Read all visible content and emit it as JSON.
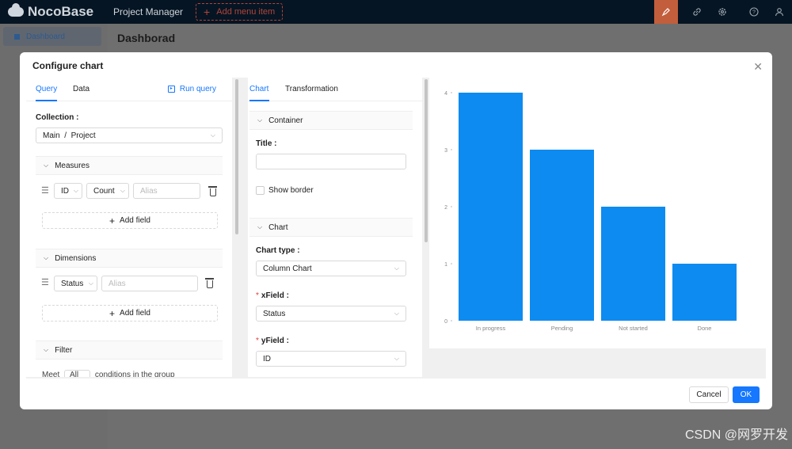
{
  "topbar": {
    "logo": "NocoBase",
    "project_menu": "Project Manager",
    "add_menu_item": "Add menu item",
    "icons": [
      "highlighter-icon",
      "link-icon",
      "gear-icon",
      "help-icon",
      "user-icon"
    ]
  },
  "sidebar": {
    "items": [
      {
        "label": "Dashboard",
        "icon": "dashboard-icon"
      }
    ]
  },
  "page": {
    "title": "Dashborad"
  },
  "modal": {
    "title": "Configure chart",
    "query_panel": {
      "tabs": [
        "Query",
        "Data"
      ],
      "run_query": "Run query",
      "collection_label": "Collection",
      "collection_value": "Main  /  Project",
      "measures": {
        "title": "Measures",
        "field": "ID",
        "aggregation": "Count",
        "alias_placeholder": "Alias",
        "add_field": "Add field"
      },
      "dimensions": {
        "title": "Dimensions",
        "field": "Status",
        "alias_placeholder": "Alias",
        "add_field": "Add field"
      },
      "filter": {
        "title": "Filter",
        "meet_prefix": "Meet",
        "meet_value": "All",
        "meet_suffix": "conditions in the group"
      }
    },
    "chart_panel": {
      "tabs": [
        "Chart",
        "Transformation"
      ],
      "container_section": "Container",
      "title_label": "Title",
      "show_border": "Show border",
      "chart_section": "Chart",
      "chart_type_label": "Chart type",
      "chart_type_value": "Column Chart",
      "xfield_label": "xField",
      "xfield_value": "Status",
      "yfield_label": "yField",
      "yfield_value": "ID"
    },
    "buttons": {
      "cancel": "Cancel",
      "ok": "OK"
    }
  },
  "chart_data": {
    "type": "bar",
    "categories": [
      "In progress",
      "Pending",
      "Not started",
      "Done"
    ],
    "values": [
      4,
      3,
      2,
      1
    ],
    "ylim": [
      0,
      4
    ],
    "yticks": [
      "0",
      "1",
      "2",
      "3",
      "4"
    ],
    "color": "#0d8bf0",
    "grid": false
  },
  "watermark": "CSDN @网罗开发"
}
